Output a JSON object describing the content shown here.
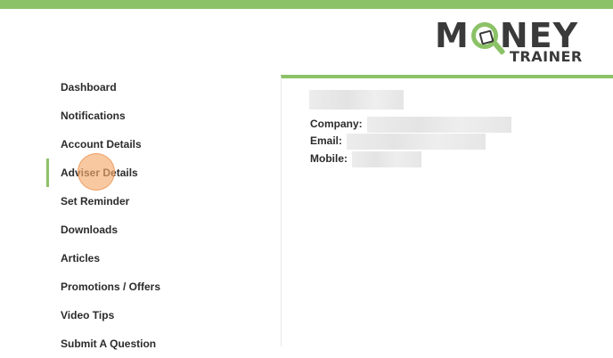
{
  "app": {
    "top_bar_color": "#8cc267"
  },
  "logo": {
    "word_left": "M",
    "word_right": "NEY",
    "subtitle": "TRAINER"
  },
  "sidebar": {
    "items": [
      {
        "label": "Dashboard",
        "active": false
      },
      {
        "label": "Notifications",
        "active": false
      },
      {
        "label": "Account Details",
        "active": false
      },
      {
        "label": "Adviser Details",
        "active": true
      },
      {
        "label": "Set Reminder",
        "active": false
      },
      {
        "label": "Downloads",
        "active": false
      },
      {
        "label": "Articles",
        "active": false
      },
      {
        "label": "Promotions / Offers",
        "active": false
      },
      {
        "label": "Video Tips",
        "active": false
      },
      {
        "label": "Submit A Question",
        "active": false
      }
    ]
  },
  "adviser": {
    "company_label": "Company:",
    "email_label": "Email:",
    "mobile_label": "Mobile:"
  }
}
